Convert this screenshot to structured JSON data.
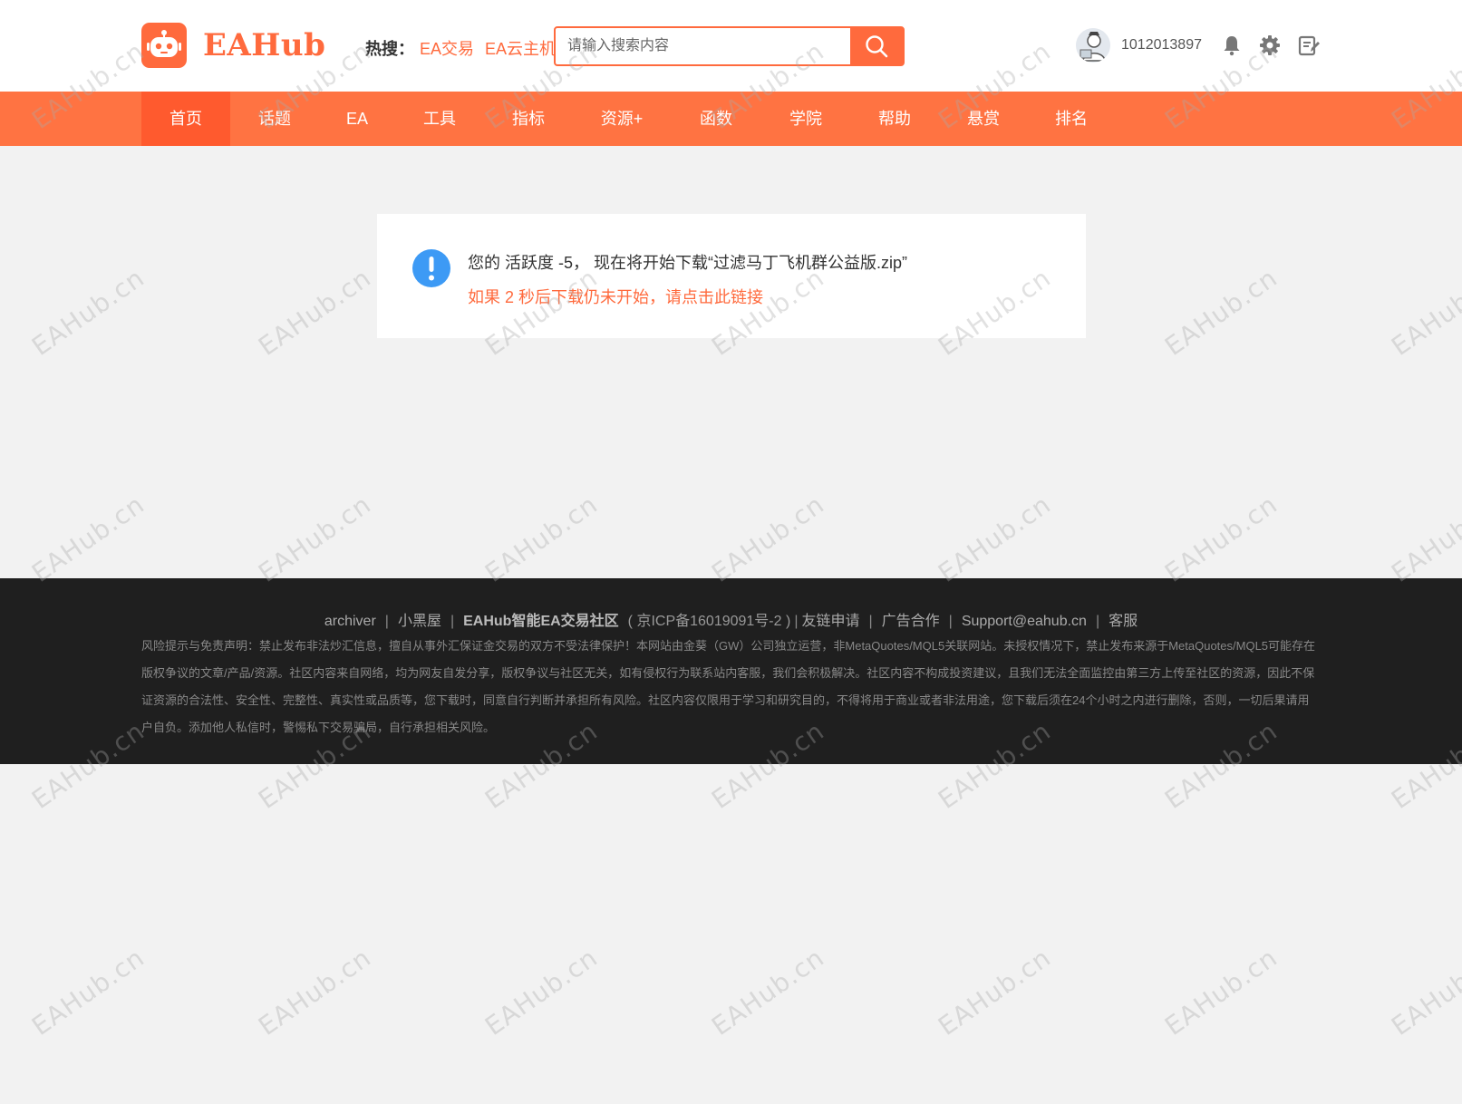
{
  "header": {
    "logo_text": "EAHub",
    "hot_label": "热搜：",
    "hot_links": [
      "EA交易",
      "EA云主机"
    ],
    "search_placeholder": "请输入搜索内容",
    "username": "1012013897"
  },
  "nav": {
    "items": [
      "首页",
      "话题",
      "EA",
      "工具",
      "指标",
      "资源+",
      "函数",
      "学院",
      "帮助",
      "悬赏",
      "排名"
    ],
    "active": "首页"
  },
  "message": {
    "line1": "您的 活跃度 -5， 现在将开始下载“过滤马丁飞机群公益版.zip”",
    "link": "如果 2 秒后下载仍未开始，请点击此链接"
  },
  "footer": {
    "links": [
      "archiver",
      "小黑屋",
      "EAHub智能EA交易社区",
      "( 京ICP备16019091号-2 )",
      "友链申请",
      "广告合作",
      "Support@eahub.cn",
      "客服"
    ],
    "disclaimer": "风险提示与免责声明：禁止发布非法炒汇信息，擅自从事外汇保证金交易的双方不受法律保护！本网站由金葵（GW）公司独立运营，非MetaQuotes/MQL5关联网站。未授权情况下，禁止发布来源于MetaQuotes/MQL5可能存在版权争议的文章/产品/资源。社区内容来自网络，均为网友自发分享，版权争议与社区无关，如有侵权行为联系站内客服，我们会积极解决。社区内容不构成投资建议，且我们无法全面监控由第三方上传至社区的资源，因此不保证资源的合法性、安全性、完整性、真实性或品质等，您下载时，同意自行判断并承担所有风险。社区内容仅限用于学习和研究目的，不得将用于商业或者非法用途，您下载后须在24个小时之内进行删除，否则，一切后果请用户自负。添加他人私信时，警惕私下交易骗局，自行承担相关风险。"
  },
  "watermark": "EAHub.cn",
  "colors": {
    "brand": "#ff6a3d",
    "nav_bg": "#ff7342",
    "nav_active": "#ff5a2e",
    "info_blue": "#3d9af5",
    "footer_bg": "#1f1f1f"
  },
  "icons": {
    "search": "search-icon",
    "bell": "bell-icon",
    "gear": "gear-icon",
    "edit": "edit-icon",
    "info": "info-icon"
  }
}
